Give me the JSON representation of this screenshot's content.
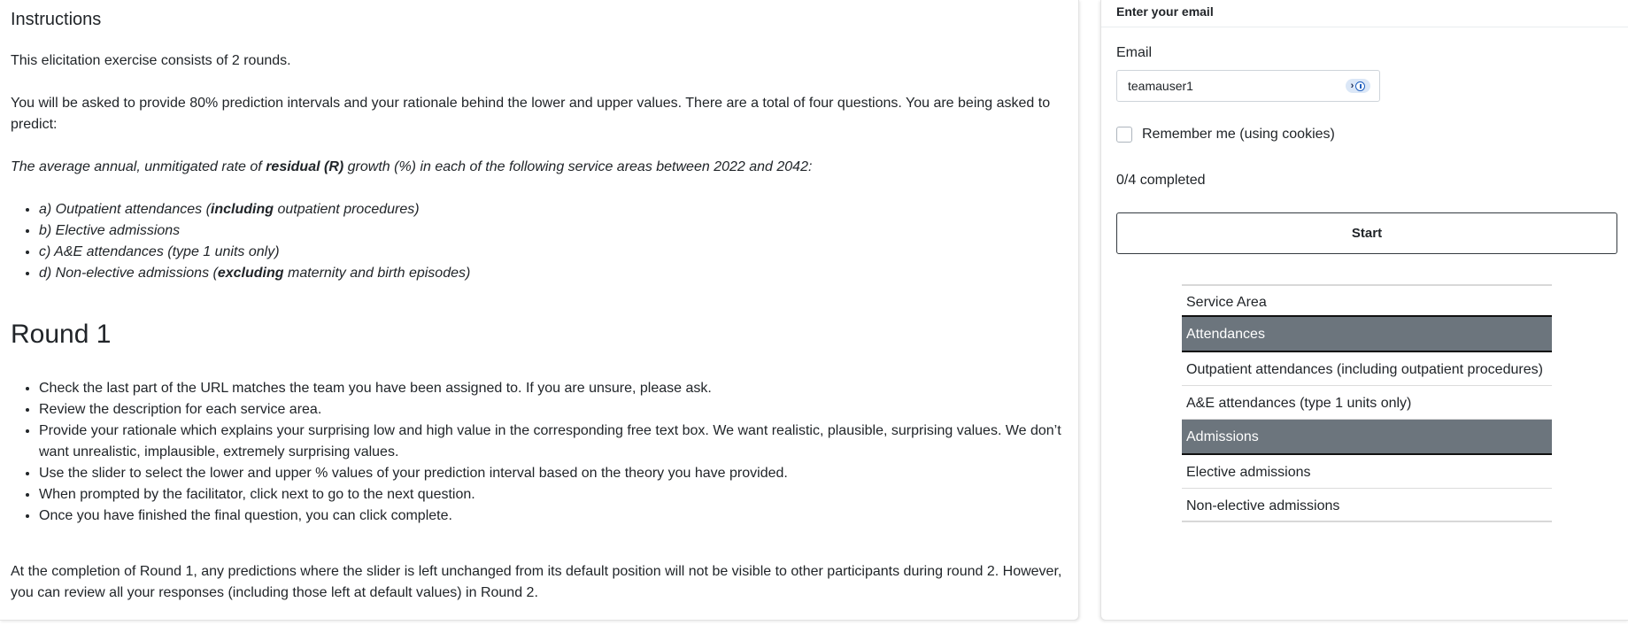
{
  "instructions": {
    "title": "Instructions",
    "intro": "This elicitation exercise consists of 2 rounds.",
    "body": "You will be asked to provide 80% prediction intervals and your rationale behind the lower and upper values. There are a total of four questions. You are being asked to predict:",
    "question_prefix": "The average annual, unmitigated rate of ",
    "question_bold": "residual (R)",
    "question_suffix": " growth (%) in each of the following service areas between 2022 and 2042:",
    "areas": [
      {
        "pre": "a) Outpatient attendances (",
        "bold": "including",
        "post": " outpatient procedures)"
      },
      {
        "pre": "b) Elective admissions",
        "bold": "",
        "post": ""
      },
      {
        "pre": "c) A&E attendances (type 1 units only)",
        "bold": "",
        "post": ""
      },
      {
        "pre": "d) Non-elective admissions (",
        "bold": "excluding",
        "post": " maternity and birth episodes)"
      }
    ]
  },
  "round1": {
    "title": "Round 1",
    "steps": [
      "Check the last part of the URL matches the team you have been assigned to. If you are unsure, please ask.",
      "Review the description for each service area.",
      "Provide your rationale which explains your surprising low and high value in the corresponding free text box. We want realistic, plausible, surprising values. We don’t want unrealistic, implausible, extremely surprising values.",
      "Use the slider to select the lower and upper % values of your prediction interval based on the theory you have provided.",
      "When prompted by the facilitator, click next to go to the next question.",
      "Once you have finished the final question, you can click complete."
    ],
    "footer": "At the completion of Round 1, any predictions where the slider is left unchanged from its default position will not be visible to other participants during round 2. However, you can review all your responses (including those left at default values) in Round 2."
  },
  "login": {
    "header": "Enter your email",
    "email_label": "Email",
    "email_value": "teamauser1",
    "remember_label": "Remember me (using cookies)",
    "remember_checked": false,
    "progress": "0/4 completed",
    "start_label": "Start"
  },
  "service_table": {
    "header": "Service Area",
    "groups": [
      {
        "name": "Attendances",
        "items": [
          "Outpatient attendances (including outpatient procedures)",
          "A&E attendances (type 1 units only)"
        ]
      },
      {
        "name": "Admissions",
        "items": [
          "Elective admissions",
          "Non-elective admissions"
        ]
      }
    ]
  },
  "icons": {
    "password_manager": "password-manager-icon"
  },
  "colors": {
    "group_row_bg": "#6c757d",
    "password_icon_accent": "#1f5fbf"
  }
}
